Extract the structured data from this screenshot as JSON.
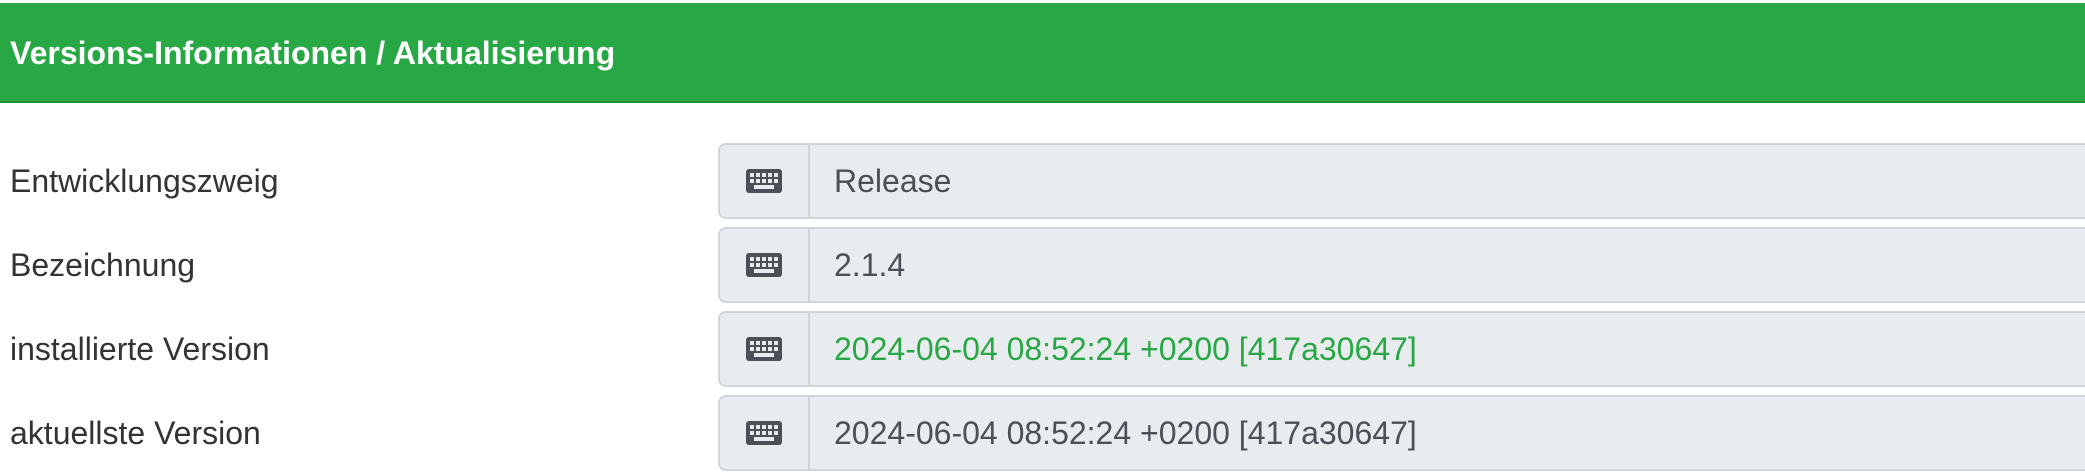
{
  "panel": {
    "title": "Versions-Informationen / Aktualisierung"
  },
  "rows": [
    {
      "label": "Entwicklungszweig",
      "value": "Release",
      "icon": "keyboard-icon"
    },
    {
      "label": "Bezeichnung",
      "value": "2.1.4",
      "icon": "keyboard-icon"
    },
    {
      "label": "installierte Version",
      "value": "2024-06-04 08:52:24 +0200 [417a30647]",
      "icon": "keyboard-icon",
      "value_color": "#28a745"
    },
    {
      "label": "aktuellste Version",
      "value": "2024-06-04 08:52:24 +0200 [417a30647]",
      "icon": "keyboard-icon"
    }
  ],
  "colors": {
    "header_bg": "#28a745",
    "header_text": "#ffffff",
    "field_bg": "#e9ecef",
    "field_border": "#ced4da",
    "value_text": "#495057",
    "success_text": "#28a745"
  }
}
